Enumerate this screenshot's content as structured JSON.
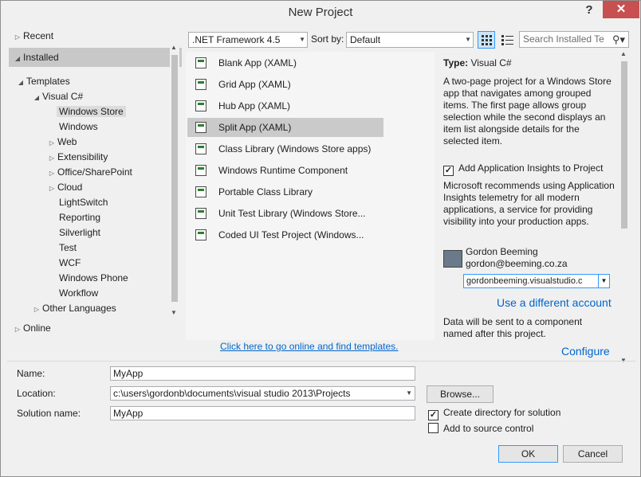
{
  "window": {
    "title": "New Project",
    "help_label": "?",
    "close_label": "✕"
  },
  "tree": {
    "recent": "Recent",
    "installed": "Installed",
    "templates": "Templates",
    "visual_csharp": "Visual C#",
    "items": [
      "Windows Store",
      "Windows",
      "Web",
      "Extensibility",
      "Office/SharePoint",
      "Cloud",
      "LightSwitch",
      "Reporting",
      "Silverlight",
      "Test",
      "WCF",
      "Windows Phone",
      "Workflow"
    ],
    "other_languages": "Other Languages",
    "online": "Online"
  },
  "toolbar": {
    "framework": ".NET Framework 4.5",
    "sort_label": "Sort by:",
    "sort_value": "Default",
    "search_placeholder": "Search Installed Te"
  },
  "templates": [
    "Blank App (XAML)",
    "Grid App (XAML)",
    "Hub App (XAML)",
    "Split App (XAML)",
    "Class Library (Windows Store apps)",
    "Windows Runtime Component",
    "Portable Class Library",
    "Unit Test Library (Windows Store...",
    "Coded UI Test Project (Windows..."
  ],
  "online_link": "Click here to go online and find templates.",
  "info": {
    "type_label": "Type:",
    "type_value": "Visual C#",
    "description": "A two-page project for a Windows Store app that navigates among grouped items. The first page allows group selection while the second displays an item list alongside details for the selected item.",
    "insights_label": "Add Application Insights to Project",
    "insights_desc": "Microsoft recommends using Application Insights telemetry for all modern applications, a service for providing visibility into your production apps.",
    "user_name": "Gordon Beeming",
    "user_email": "gordon@beeming.co.za",
    "account": "gordonbeeming.visualstudio.c",
    "different_account": "Use a different account",
    "data_note": "Data will be sent to a component named after this project.",
    "configure": "Configure"
  },
  "form": {
    "name_label": "Name:",
    "name_value": "MyApp",
    "location_label": "Location:",
    "location_value": "c:\\users\\gordonb\\documents\\visual studio 2013\\Projects",
    "browse": "Browse...",
    "solution_label": "Solution name:",
    "solution_value": "MyApp",
    "create_dir": "Create directory for solution",
    "add_source": "Add to source control",
    "ok": "OK",
    "cancel": "Cancel"
  }
}
